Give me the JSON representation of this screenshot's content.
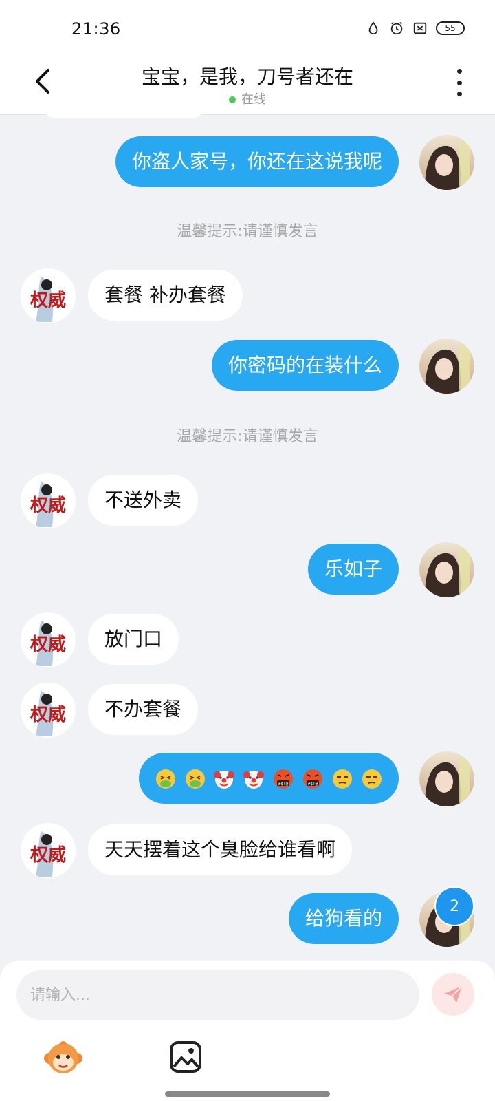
{
  "status_bar": {
    "time": "21:36",
    "battery": "55"
  },
  "header": {
    "title": "宝宝，是我，刀号者还在",
    "status": "在线"
  },
  "messages": [
    {
      "side": "right",
      "text": "你盗人家号，你还在这说我呢"
    },
    {
      "side": "hint",
      "text": "温馨提示:请谨慎发言"
    },
    {
      "side": "left",
      "text": "套餐 补办套餐"
    },
    {
      "side": "right",
      "text": "你密码的在装什么"
    },
    {
      "side": "hint",
      "text": "温馨提示:请谨慎发言"
    },
    {
      "side": "left",
      "text": "不送外卖"
    },
    {
      "side": "right",
      "text": "乐如子"
    },
    {
      "side": "left",
      "text": "放门口"
    },
    {
      "side": "left",
      "text": "不办套餐"
    },
    {
      "side": "right",
      "emojis": [
        "nauseated-face",
        "nauseated-face",
        "clown-face",
        "clown-face",
        "cursing-face",
        "cursing-face",
        "unamused-face",
        "unamused-face"
      ]
    },
    {
      "side": "left",
      "text": "天天摆着这个臭脸给谁看啊"
    },
    {
      "side": "right",
      "text": "给狗看的"
    }
  ],
  "avatar_left_text": "权威",
  "unread_badge": "2",
  "input": {
    "placeholder": "请输入..."
  },
  "colors": {
    "outgoing_bubble": "#29a8f2",
    "incoming_bubble": "#ffffff",
    "background": "#f1f2f6",
    "online_dot": "#4cc95d",
    "badge": "#1f96ee",
    "send_button_bg": "#fde6e6"
  },
  "icons": {
    "back": "chevron-left-icon",
    "more": "more-vertical-icon",
    "send": "send-icon",
    "emoji_tool": "monkey-emoji-icon",
    "image_tool": "image-icon"
  }
}
